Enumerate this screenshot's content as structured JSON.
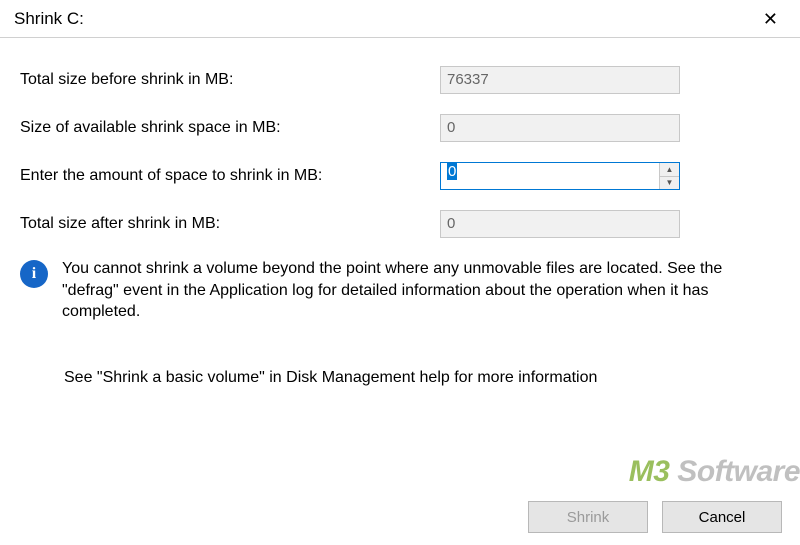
{
  "titlebar": {
    "title": "Shrink C:"
  },
  "rows": {
    "total_before": {
      "label": "Total size before shrink in MB:",
      "value": "76337"
    },
    "available": {
      "label": "Size of available shrink space in MB:",
      "value": "0"
    },
    "enter": {
      "label": "Enter the amount of space to shrink in MB:",
      "value": "0"
    },
    "total_after": {
      "label": "Total size after shrink in MB:",
      "value": "0"
    }
  },
  "info": {
    "text": "You cannot shrink a volume beyond the point where any unmovable files are located. See the \"defrag\" event in the Application log for detailed information about the operation when it has completed."
  },
  "help": {
    "text": "See \"Shrink a basic volume\" in Disk Management help for more information"
  },
  "watermark": {
    "brand": "M3",
    "suffix": " Software"
  },
  "buttons": {
    "shrink": "Shrink",
    "cancel": "Cancel"
  }
}
